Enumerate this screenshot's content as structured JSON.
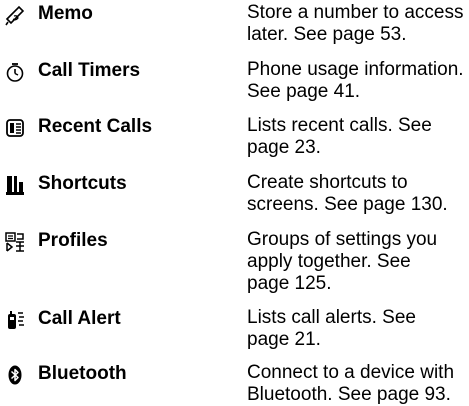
{
  "features": [
    {
      "icon": "memo-icon",
      "name": "Memo",
      "desc_lines": [
        "Store a number to access",
        "later. See page 53."
      ]
    },
    {
      "icon": "call-timers-icon",
      "name": "Call Timers",
      "desc_lines": [
        "Phone usage information.",
        "See page 41."
      ]
    },
    {
      "icon": "recent-calls-icon",
      "name": "Recent Calls",
      "desc_lines": [
        "Lists recent calls. See",
        "page 23."
      ]
    },
    {
      "icon": "shortcuts-icon",
      "name": "Shortcuts",
      "desc_lines": [
        "Create shortcuts to",
        "screens. See page 130."
      ]
    },
    {
      "icon": "profiles-icon",
      "name": "Profiles",
      "desc_lines": [
        "Groups of settings you",
        "apply together. See",
        "page 125."
      ]
    },
    {
      "icon": "call-alert-icon",
      "name": "Call Alert",
      "desc_lines": [
        "Lists call alerts. See",
        "page 21."
      ]
    },
    {
      "icon": "bluetooth-icon",
      "name": "Bluetooth",
      "desc_lines": [
        "Connect to a device with",
        "Bluetooth. See page 93."
      ]
    }
  ]
}
